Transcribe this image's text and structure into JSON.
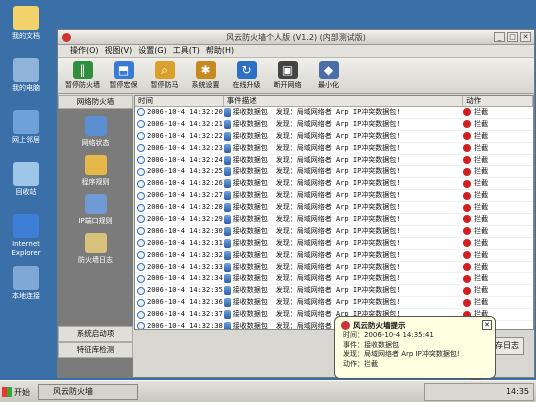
{
  "desktop": {
    "icons": [
      {
        "label": "我的文档",
        "color": "#f2d36b"
      },
      {
        "label": "我的电脑",
        "color": "#8fb3d9"
      },
      {
        "label": "网上邻居",
        "color": "#6fa0d8"
      },
      {
        "label": "回收站",
        "color": "#9ec6e8"
      },
      {
        "label": "Internet Explorer",
        "color": "#3d7fd6"
      },
      {
        "label": "本地连接",
        "color": "#7fa8d6"
      }
    ]
  },
  "window": {
    "title": "风云防火墙个人版 (V1.2) (内部测试版)",
    "close_glyph": "✕",
    "max_glyph": "□",
    "min_glyph": "_"
  },
  "menu": [
    "操作(O)",
    "视图(V)",
    "设置(G)",
    "工具(T)",
    "帮助(H)"
  ],
  "toolbar": [
    {
      "label": "暂停防火墙",
      "icon": "pause-icon",
      "color": "#2f8f3f",
      "glyph": "‖"
    },
    {
      "label": "暂停宏保",
      "icon": "shield-icon",
      "color": "#3a7bd5",
      "glyph": "⬒"
    },
    {
      "label": "暂停防马",
      "icon": "magnifier-icon",
      "color": "#d9a12b",
      "glyph": "⌕"
    },
    {
      "label": "系统设置",
      "icon": "gear-icon",
      "color": "#c78a20",
      "glyph": "✱"
    },
    {
      "label": "在线升级",
      "icon": "update-icon",
      "color": "#2d6fc4",
      "glyph": "↻"
    },
    {
      "label": "断开网络",
      "icon": "disconnect-icon",
      "color": "#444444",
      "glyph": "▣"
    },
    {
      "label": "最小化",
      "icon": "minimize-icon",
      "color": "#4a6fa8",
      "glyph": "◆"
    }
  ],
  "sidebar": {
    "header": "网络防火墙",
    "items": [
      {
        "label": "网络状态",
        "icon": "home-icon",
        "color": "#5b8fd1"
      },
      {
        "label": "程序规则",
        "icon": "program-icon",
        "color": "#e6b84a"
      },
      {
        "label": "IP端口规则",
        "icon": "port-icon",
        "color": "#6f9ad3"
      },
      {
        "label": "防火墙日志",
        "icon": "log-icon",
        "color": "#d9c27a"
      }
    ],
    "footer": [
      "系统启动项",
      "特征库检测"
    ]
  },
  "log": {
    "columns": [
      "时间",
      "事件描述",
      "动作"
    ],
    "rows": [
      {
        "time": "2006-10-4 14:32:20",
        "event": "接收数据包",
        "desc": "发现：局域网络者 Arp IP冲突数据包!",
        "action": "拦截"
      },
      {
        "time": "2006-10-4 14:32:21",
        "event": "接收数据包",
        "desc": "发现：局域网络者 Arp IP冲突数据包!",
        "action": "拦截"
      },
      {
        "time": "2006-10-4 14:32:22",
        "event": "接收数据包",
        "desc": "发现：局域网络者 Arp IP冲突数据包!",
        "action": "拦截"
      },
      {
        "time": "2006-10-4 14:32:23",
        "event": "接收数据包",
        "desc": "发现：局域网络者 Arp IP冲突数据包!",
        "action": "拦截"
      },
      {
        "time": "2006-10-4 14:32:24",
        "event": "接收数据包",
        "desc": "发现：局域网络者 Arp IP冲突数据包!",
        "action": "拦截"
      },
      {
        "time": "2006-10-4 14:32:25",
        "event": "接收数据包",
        "desc": "发现：局域网络者 Arp IP冲突数据包!",
        "action": "拦截"
      },
      {
        "time": "2006-10-4 14:32:26",
        "event": "接收数据包",
        "desc": "发现：局域网络者 Arp IP冲突数据包!",
        "action": "拦截"
      },
      {
        "time": "2006-10-4 14:32:27",
        "event": "接收数据包",
        "desc": "发现：局域网络者 Arp IP冲突数据包!",
        "action": "拦截"
      },
      {
        "time": "2006-10-4 14:32:28",
        "event": "接收数据包",
        "desc": "发现：局域网络者 Arp IP冲突数据包!",
        "action": "拦截"
      },
      {
        "time": "2006-10-4 14:32:29",
        "event": "接收数据包",
        "desc": "发现：局域网络者 Arp IP冲突数据包!",
        "action": "拦截"
      },
      {
        "time": "2006-10-4 14:32:30",
        "event": "接收数据包",
        "desc": "发现：局域网络者 Arp IP冲突数据包!",
        "action": "拦截"
      },
      {
        "time": "2006-10-4 14:32:31",
        "event": "接收数据包",
        "desc": "发现：局域网络者 Arp IP冲突数据包!",
        "action": "拦截"
      },
      {
        "time": "2006-10-4 14:32:32",
        "event": "接收数据包",
        "desc": "发现：局域网络者 Arp IP冲突数据包!",
        "action": "拦截"
      },
      {
        "time": "2006-10-4 14:32:33",
        "event": "接收数据包",
        "desc": "发现：局域网络者 Arp IP冲突数据包!",
        "action": "拦截"
      },
      {
        "time": "2006-10-4 14:32:34",
        "event": "接收数据包",
        "desc": "发现：局域网络者 Arp IP冲突数据包!",
        "action": "拦截"
      },
      {
        "time": "2006-10-4 14:32:35",
        "event": "接收数据包",
        "desc": "发现：局域网络者 Arp IP冲突数据包!",
        "action": "拦截"
      },
      {
        "time": "2006-10-4 14:32:36",
        "event": "接收数据包",
        "desc": "发现：局域网络者 Arp IP冲突数据包!",
        "action": "拦截"
      },
      {
        "time": "2006-10-4 14:32:37",
        "event": "接收数据包",
        "desc": "发现：局域网络者 Arp IP冲突数据包!",
        "action": "拦截"
      },
      {
        "time": "2006-10-4 14:32:38",
        "event": "接收数据包",
        "desc": "发现：局域网络者 Arp IP冲突数据包!",
        "action": "拦截"
      },
      {
        "time": "2006-10-4 14:32:39",
        "event": "接收数据包",
        "desc": "发现：局域网络者 Arp IP冲突数据包!",
        "action": "拦截"
      },
      {
        "time": "2006-10-4 14:32:40",
        "event": "接收数据包",
        "desc": "发现：局域网络者 Arp IP冲突数据包!",
        "action": "拦截"
      }
    ]
  },
  "save_button": "存日志",
  "balloon": {
    "title": "风云防火墙提示",
    "lines": [
      "时间：2006-10-4 14:35:41",
      "事件：接收数据包",
      "发现：局域网络者 Arp IP冲突数据包!",
      "动作：拦截"
    ]
  },
  "taskbar": {
    "start": "开始",
    "task": "风云防火墙",
    "clock": "14:35"
  }
}
